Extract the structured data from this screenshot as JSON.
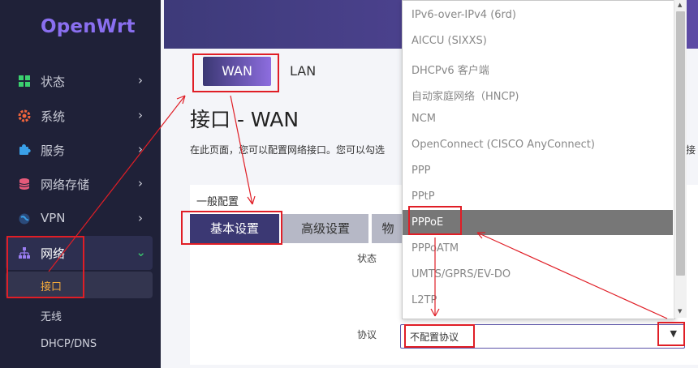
{
  "sidebar": {
    "logo": "OpenWrt",
    "items": [
      {
        "label": "状态",
        "icon": "dashboard-icon"
      },
      {
        "label": "系统",
        "icon": "gear-icon"
      },
      {
        "label": "服务",
        "icon": "puzzle-icon"
      },
      {
        "label": "网络存储",
        "icon": "database-icon"
      },
      {
        "label": "VPN",
        "icon": "globe-icon"
      },
      {
        "label": "网络",
        "icon": "network-icon"
      }
    ],
    "subitems": [
      {
        "label": "接口"
      },
      {
        "label": "无线"
      },
      {
        "label": "DHCP/DNS"
      }
    ]
  },
  "tabs": {
    "wan": "WAN",
    "lan": "LAN"
  },
  "page": {
    "title": "接口 - WAN",
    "description": "在此页面，您可以配置网络接口。您可以勾选",
    "description_right": "接"
  },
  "config": {
    "section_title": "一般配置",
    "subtabs": [
      "基本设置",
      "高级设置",
      "物"
    ],
    "status_label": "状态",
    "protocol_label": "协议",
    "protocol_value": "不配置协议"
  },
  "dropdown": {
    "options": [
      "IPv6-over-IPv4 (6rd)",
      "AICCU (SIXXS)",
      "DHCPv6 客户端",
      "自动家庭网络（HNCP)",
      "NCM",
      "OpenConnect (CISCO AnyConnect)",
      "PPP",
      "PPtP",
      "PPPoE",
      "PPPoATM",
      "UMTS/GPRS/EV-DO",
      "L2TP"
    ],
    "selected": "PPPoE"
  },
  "colors": {
    "sidebar_bg": "#1f2138",
    "accent": "#3b3873",
    "highlight": "#e01e26",
    "active_sub": "#f3a93b"
  }
}
